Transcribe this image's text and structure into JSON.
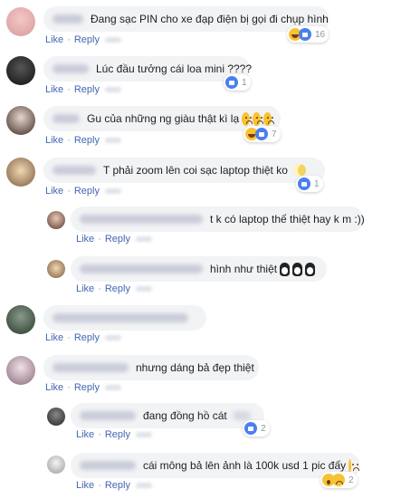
{
  "actions": {
    "like": "Like",
    "reply": "Reply"
  },
  "comments": [
    {
      "text": "Đang sạc PIN cho xe đạp điện bị gọi đi chụp hình",
      "reaction_count": "16"
    },
    {
      "text": "Lúc đầu tưởng cái loa mini ????",
      "reaction_count": "1"
    },
    {
      "text": "Gu của những ng giàu thật kì lạ",
      "reaction_count": "7"
    },
    {
      "text": "T phải zoom lên coi sạc laptop thiệt ko",
      "reaction_count": "1"
    },
    {
      "text": "t k có laptop thế thiệt hay k m :))",
      "reaction_count": ""
    },
    {
      "text": "hình như thiệt",
      "reaction_count": ""
    },
    {
      "text": "",
      "reaction_count": ""
    },
    {
      "text": "nhưng dáng bả đẹp thiệt",
      "reaction_count": ""
    },
    {
      "text": "đang đồng hồ cát",
      "reaction_count": "2"
    },
    {
      "text": "cái mông bả lên ảnh là 100k usd 1 pic đấy",
      "reaction_count": "2"
    }
  ],
  "colors": {
    "link": "#4267b2",
    "bubble": "#f2f3f5",
    "like": "#4a7ff0",
    "emoji": "#f7c234"
  }
}
